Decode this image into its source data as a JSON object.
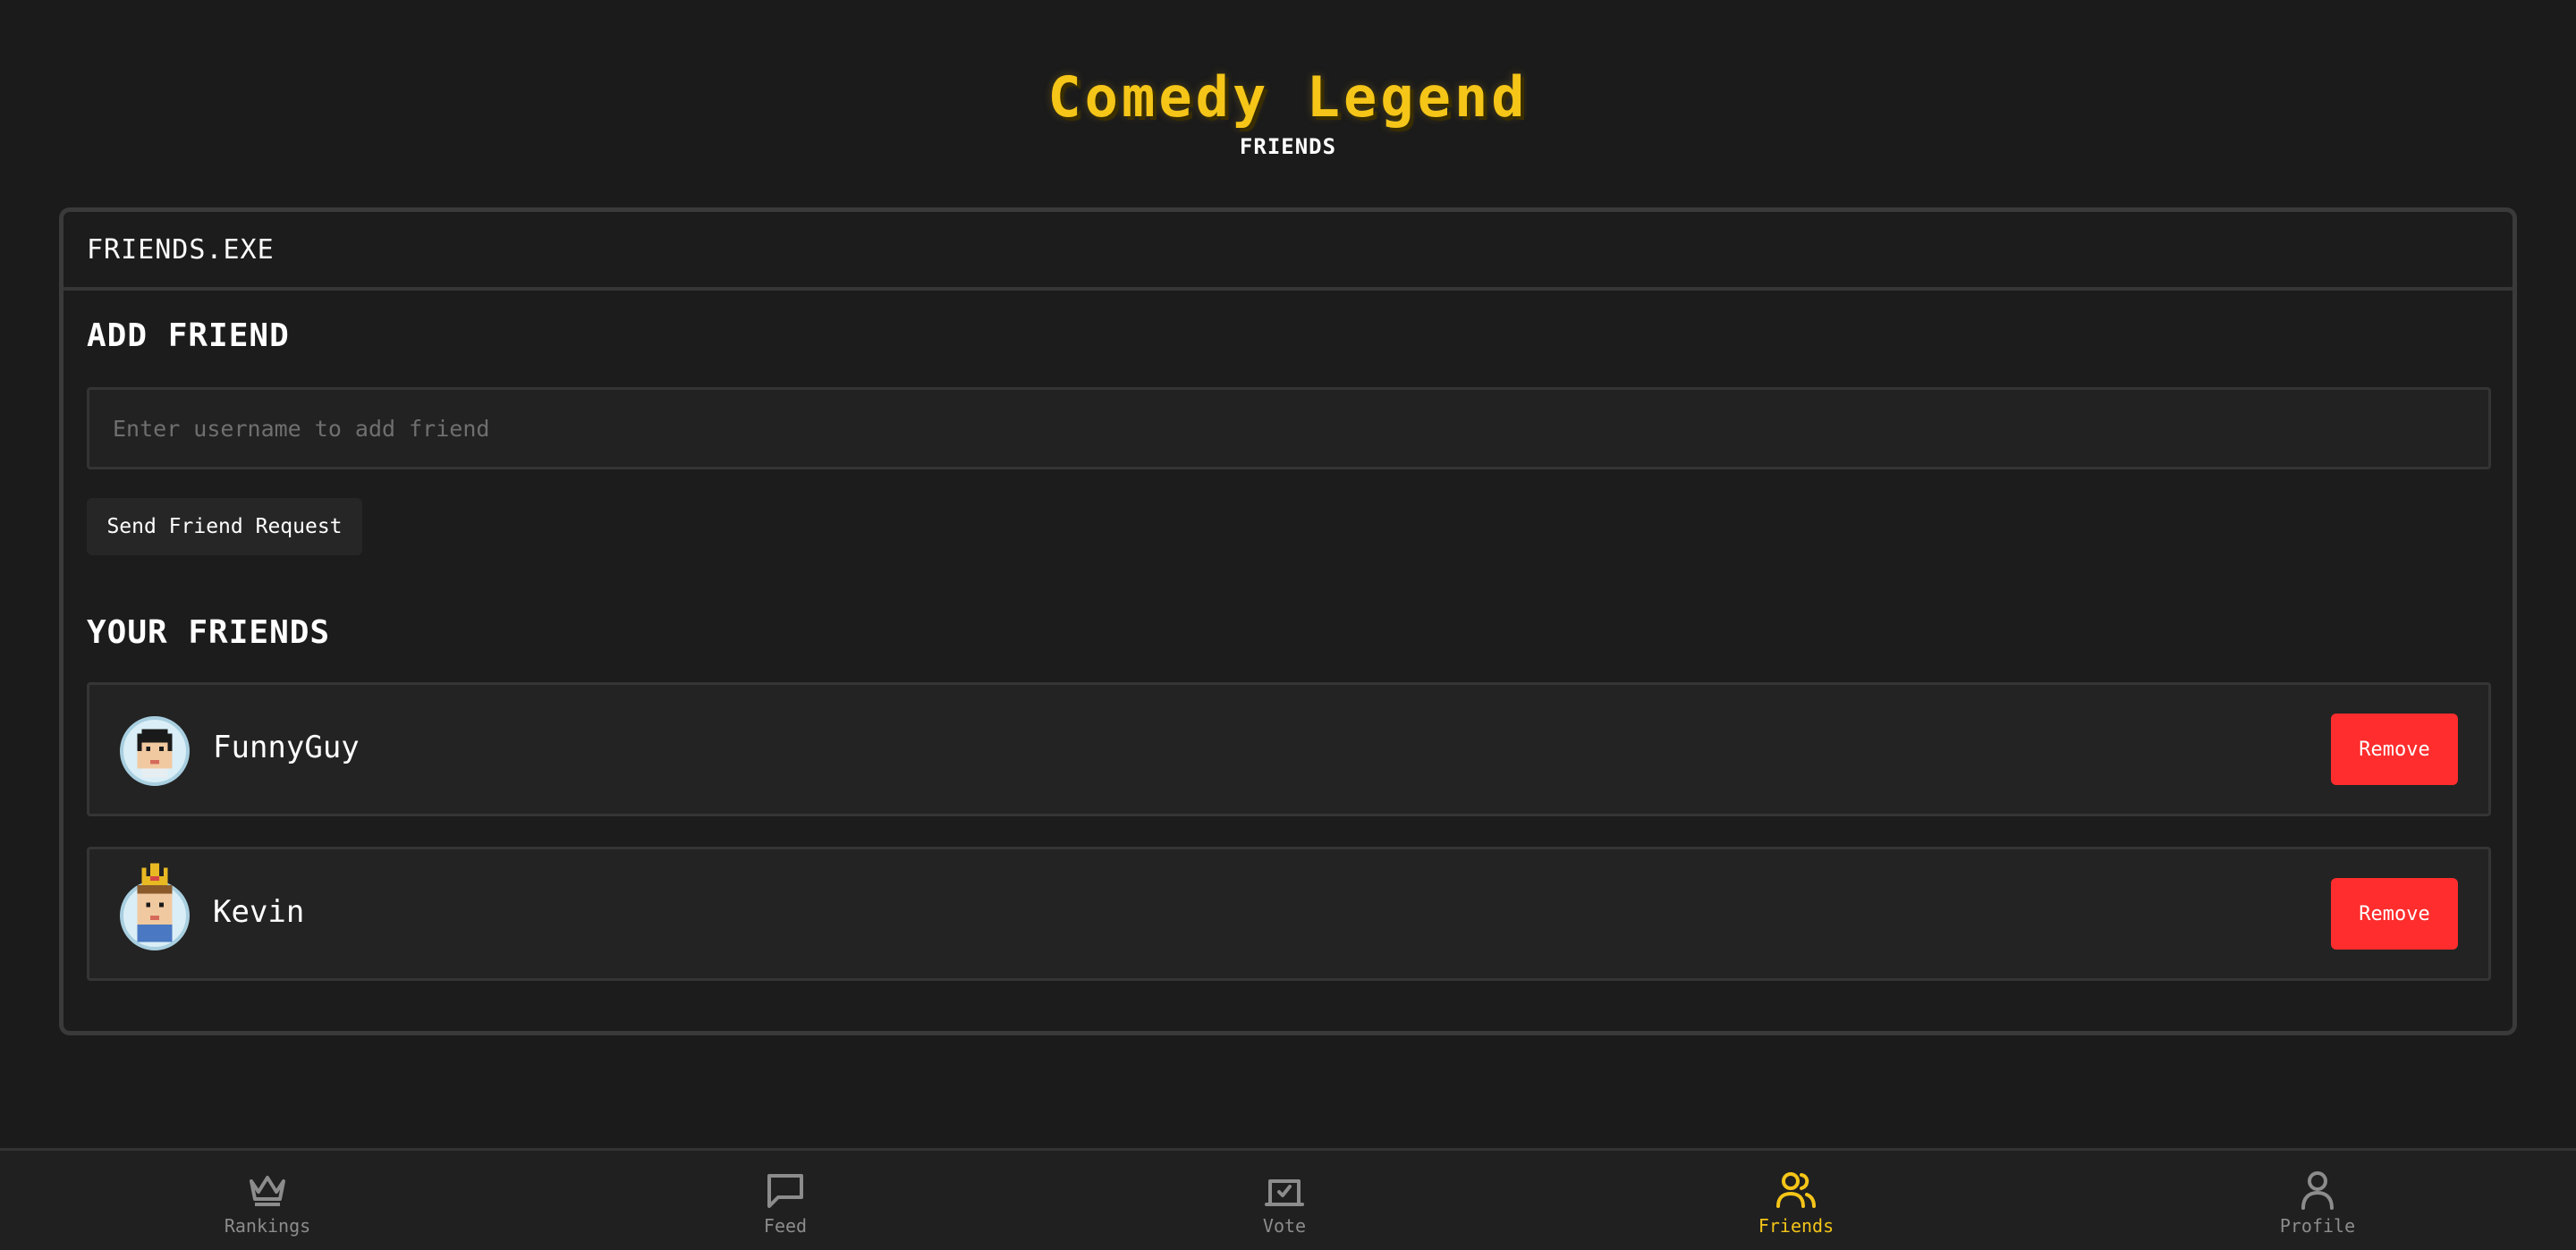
{
  "header": {
    "app_title": "Comedy Legend",
    "page_subtitle": "FRIENDS"
  },
  "window": {
    "title": "FRIENDS.EXE",
    "add_friend": {
      "heading": "ADD FRIEND",
      "input_placeholder": "Enter username to add friend",
      "input_value": "",
      "send_button_label": "Send Friend Request"
    },
    "friends": {
      "heading": "YOUR FRIENDS",
      "list": [
        {
          "name": "FunnyGuy",
          "avatar": "pixel-face-avatar",
          "remove_label": "Remove"
        },
        {
          "name": "Kevin",
          "avatar": "pixel-crowned-face-avatar",
          "remove_label": "Remove"
        }
      ]
    }
  },
  "nav": {
    "items": [
      {
        "label": "Rankings",
        "icon": "crown-icon",
        "active": false
      },
      {
        "label": "Feed",
        "icon": "chat-bubble-icon",
        "active": false
      },
      {
        "label": "Vote",
        "icon": "ballot-box-icon",
        "active": false
      },
      {
        "label": "Friends",
        "icon": "users-icon",
        "active": true
      },
      {
        "label": "Profile",
        "icon": "user-icon",
        "active": false
      }
    ]
  },
  "colors": {
    "accent": "#f5c518",
    "danger": "#ff2d2d",
    "background": "#1b1b1b"
  }
}
